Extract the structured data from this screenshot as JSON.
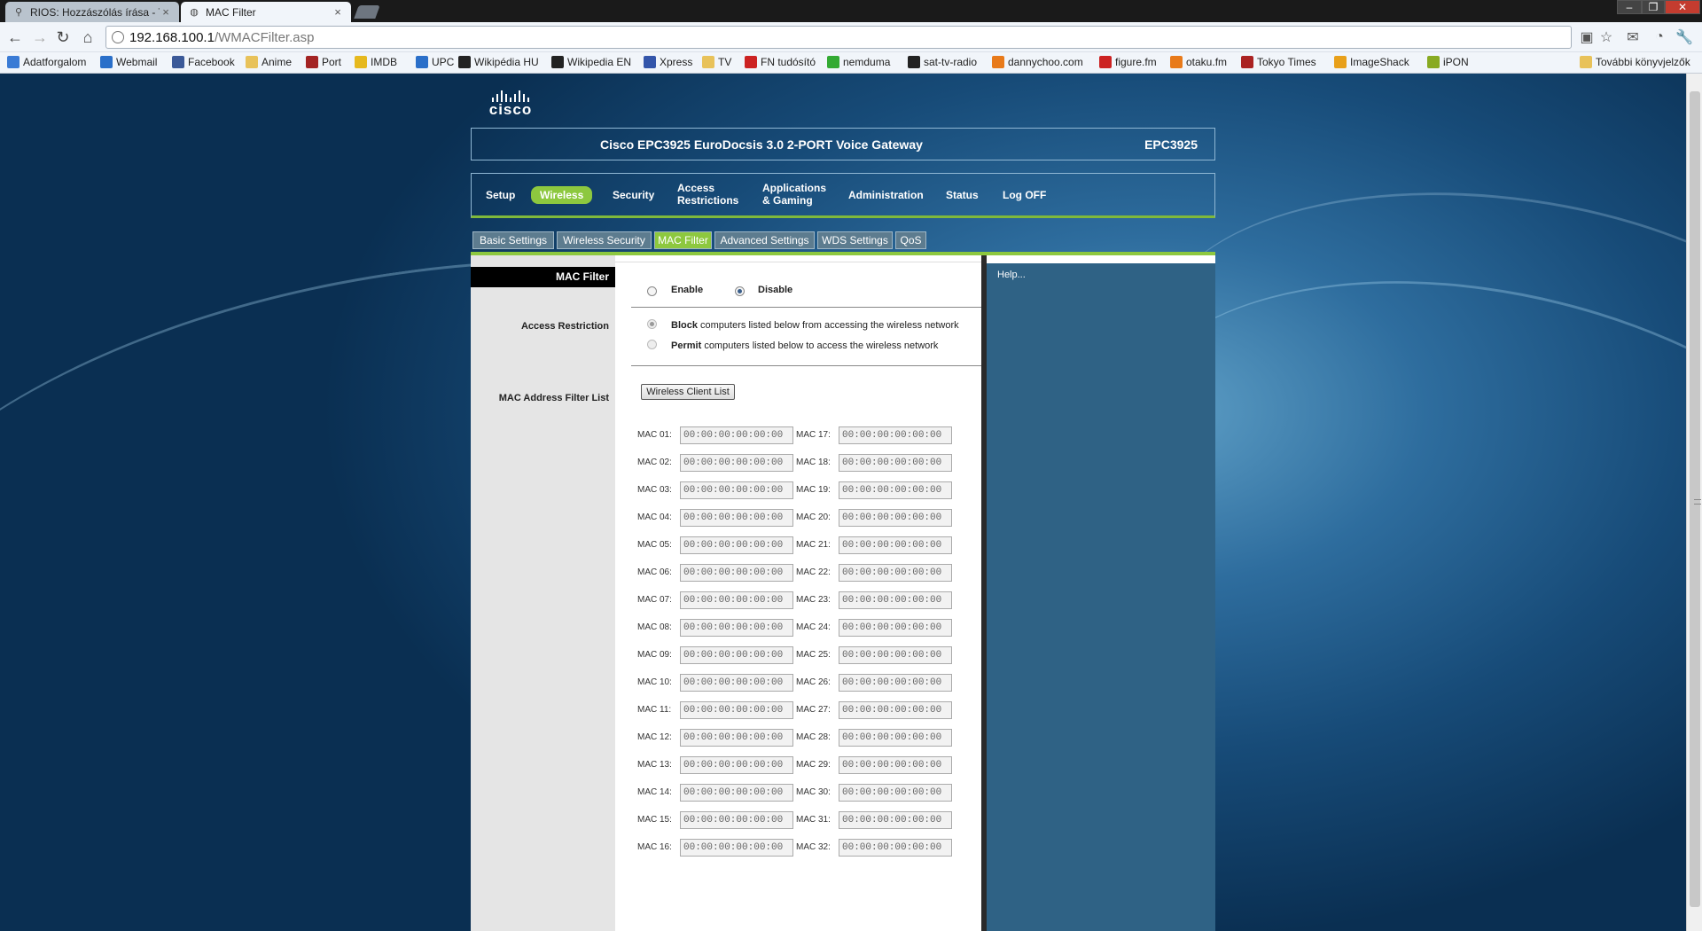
{
  "browser": {
    "tabs": [
      {
        "title": "RIOS: Hozzászólás írása - Té",
        "active": false
      },
      {
        "title": "MAC Filter",
        "active": true
      }
    ],
    "address": {
      "host": "192.168.100.1",
      "path": "/WMACFilter.asp"
    },
    "bookmarks": [
      {
        "label": "Adatforgalom",
        "icon": "bar-chart-icon",
        "color": "#3a7bd5"
      },
      {
        "label": "Webmail",
        "icon": "globe-icon",
        "color": "#2a6fc9"
      },
      {
        "label": "Facebook",
        "icon": "facebook-icon",
        "color": "#3b5998"
      },
      {
        "label": "Anime",
        "icon": "folder-icon",
        "color": "#e8c25a"
      },
      {
        "label": "Port",
        "icon": "port-icon",
        "color": "#a32323"
      },
      {
        "label": "IMDB",
        "icon": "imdb-icon",
        "color": "#e6b91e"
      },
      {
        "label": "UPC",
        "icon": "upc-icon",
        "color": "#2a6fc9"
      },
      {
        "label": "Wikipédia HU",
        "icon": "wikipedia-icon",
        "color": "#222"
      },
      {
        "label": "Wikipedia EN",
        "icon": "wikipedia-icon",
        "color": "#222"
      },
      {
        "label": "Xpress",
        "icon": "xpress-icon",
        "color": "#3355aa"
      },
      {
        "label": "TV",
        "icon": "folder-icon",
        "color": "#e8c25a"
      },
      {
        "label": "FN tudósító",
        "icon": "fn-icon",
        "color": "#cc2222"
      },
      {
        "label": "nemduma",
        "icon": "leaf-icon",
        "color": "#33aa33"
      },
      {
        "label": "sat-tv-radio",
        "icon": "sat-icon",
        "color": "#222"
      },
      {
        "label": "dannychoo.com",
        "icon": "dannychoo-icon",
        "color": "#e87a1a"
      },
      {
        "label": "figure.fm",
        "icon": "figure-icon",
        "color": "#cc2222"
      },
      {
        "label": "otaku.fm",
        "icon": "otaku-icon",
        "color": "#e87a1a"
      },
      {
        "label": "Tokyo Times",
        "icon": "tokyo-icon",
        "color": "#aa2222"
      },
      {
        "label": "ImageShack",
        "icon": "imageshack-icon",
        "color": "#e8a01a"
      },
      {
        "label": "iPON",
        "icon": "ipon-icon",
        "color": "#88aa22"
      }
    ],
    "other_bookmarks": "További könyvjelzők"
  },
  "router": {
    "brand": "cisco",
    "title": "Cisco EPC3925 EuroDocsis 3.0 2-PORT Voice Gateway",
    "model": "EPC3925",
    "main_nav": [
      {
        "label": "Setup",
        "active": false
      },
      {
        "label": "Wireless",
        "active": true
      },
      {
        "label": "Security",
        "active": false
      },
      {
        "label": "Access Restrictions",
        "line1": "Access",
        "line2": "Restrictions",
        "active": false
      },
      {
        "label": "Applications & Gaming",
        "line1": "Applications",
        "line2": "& Gaming",
        "active": false
      },
      {
        "label": "Administration",
        "active": false
      },
      {
        "label": "Status",
        "active": false
      },
      {
        "label": "Log OFF",
        "active": false
      }
    ],
    "sub_nav": [
      {
        "label": "Basic Settings",
        "active": false
      },
      {
        "label": "Wireless Security",
        "active": false
      },
      {
        "label": "MAC Filter",
        "active": true
      },
      {
        "label": "Advanced Settings",
        "active": false
      },
      {
        "label": "WDS Settings",
        "active": false
      },
      {
        "label": "QoS",
        "active": false
      }
    ]
  },
  "mac_filter": {
    "section_title": "MAC Filter",
    "enable_label": "Enable",
    "disable_label": "Disable",
    "selected": "Disable",
    "access_restriction_label": "Access Restriction",
    "block_bold": "Block",
    "block_text": "computers listed below from accessing the wireless network",
    "permit_bold": "Permit",
    "permit_text": "computers listed below to access the wireless network",
    "restriction_selected": "Block",
    "filter_list_label": "MAC Address Filter List",
    "client_list_button": "Wireless Client List",
    "help_link": "Help...",
    "entries": [
      {
        "label": "MAC 01:",
        "value": "00:00:00:00:00:00"
      },
      {
        "label": "MAC 02:",
        "value": "00:00:00:00:00:00"
      },
      {
        "label": "MAC 03:",
        "value": "00:00:00:00:00:00"
      },
      {
        "label": "MAC 04:",
        "value": "00:00:00:00:00:00"
      },
      {
        "label": "MAC 05:",
        "value": "00:00:00:00:00:00"
      },
      {
        "label": "MAC 06:",
        "value": "00:00:00:00:00:00"
      },
      {
        "label": "MAC 07:",
        "value": "00:00:00:00:00:00"
      },
      {
        "label": "MAC 08:",
        "value": "00:00:00:00:00:00"
      },
      {
        "label": "MAC 09:",
        "value": "00:00:00:00:00:00"
      },
      {
        "label": "MAC 10:",
        "value": "00:00:00:00:00:00"
      },
      {
        "label": "MAC 11:",
        "value": "00:00:00:00:00:00"
      },
      {
        "label": "MAC 12:",
        "value": "00:00:00:00:00:00"
      },
      {
        "label": "MAC 13:",
        "value": "00:00:00:00:00:00"
      },
      {
        "label": "MAC 14:",
        "value": "00:00:00:00:00:00"
      },
      {
        "label": "MAC 15:",
        "value": "00:00:00:00:00:00"
      },
      {
        "label": "MAC 16:",
        "value": "00:00:00:00:00:00"
      },
      {
        "label": "MAC 17:",
        "value": "00:00:00:00:00:00"
      },
      {
        "label": "MAC 18:",
        "value": "00:00:00:00:00:00"
      },
      {
        "label": "MAC 19:",
        "value": "00:00:00:00:00:00"
      },
      {
        "label": "MAC 20:",
        "value": "00:00:00:00:00:00"
      },
      {
        "label": "MAC 21:",
        "value": "00:00:00:00:00:00"
      },
      {
        "label": "MAC 22:",
        "value": "00:00:00:00:00:00"
      },
      {
        "label": "MAC 23:",
        "value": "00:00:00:00:00:00"
      },
      {
        "label": "MAC 24:",
        "value": "00:00:00:00:00:00"
      },
      {
        "label": "MAC 25:",
        "value": "00:00:00:00:00:00"
      },
      {
        "label": "MAC 26:",
        "value": "00:00:00:00:00:00"
      },
      {
        "label": "MAC 27:",
        "value": "00:00:00:00:00:00"
      },
      {
        "label": "MAC 28:",
        "value": "00:00:00:00:00:00"
      },
      {
        "label": "MAC 29:",
        "value": "00:00:00:00:00:00"
      },
      {
        "label": "MAC 30:",
        "value": "00:00:00:00:00:00"
      },
      {
        "label": "MAC 31:",
        "value": "00:00:00:00:00:00"
      },
      {
        "label": "MAC 32:",
        "value": "00:00:00:00:00:00"
      }
    ]
  }
}
